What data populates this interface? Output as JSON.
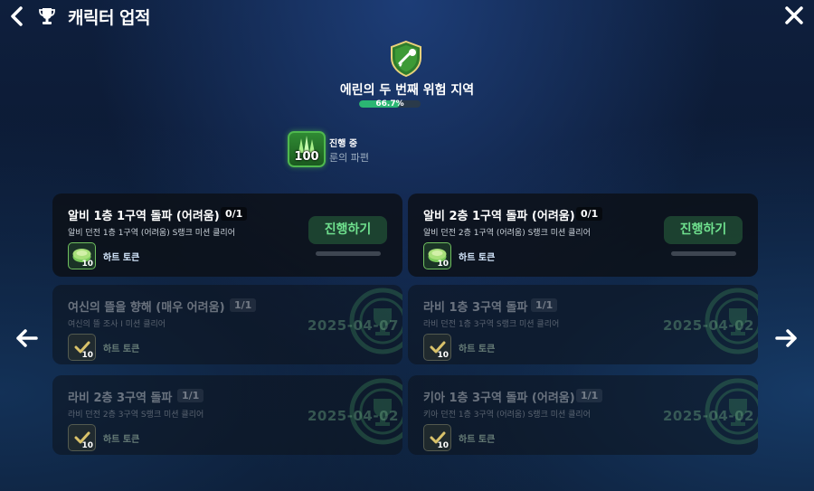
{
  "header": {
    "title": "캐릭터 업적"
  },
  "zone": {
    "title": "에린의 두 번째 위험 지역",
    "progress_text": "66.7%",
    "progress_fraction": 0.667
  },
  "in_progress": {
    "status": "진행 중",
    "name": "룬의 파편",
    "count": "100"
  },
  "cards": [
    {
      "title": "알비 1층 1구역 돌파 (어려움)",
      "count": "0/1",
      "desc": "알비 던전 1층 1구역 (어려움) S랭크 미션 클리어",
      "reward_label": "하트 토큰",
      "reward_qty": "10",
      "button": "진행하기"
    },
    {
      "title": "알비 2층 1구역 돌파 (어려움)",
      "count": "0/1",
      "desc": "알비 던전 2층 1구역 (어려움) S랭크 미션 클리어",
      "reward_label": "하트 토큰",
      "reward_qty": "10",
      "button": "진행하기"
    },
    {
      "title": "여신의 뜰을 향해 (매우 어려움)",
      "count": "1/1",
      "desc": "여신의 뜰 조사 I 미션 클리어",
      "reward_label": "하트 토큰",
      "reward_qty": "10",
      "date": "2025-04-07"
    },
    {
      "title": "라비 1층 3구역 돌파",
      "count": "1/1",
      "desc": "라비 던전 1층 3구역 S랭크 미션 클리어",
      "reward_label": "하트 토큰",
      "reward_qty": "10",
      "date": "2025-04-02"
    },
    {
      "title": "라비 2층 3구역 돌파",
      "count": "1/1",
      "desc": "라비 던전 2층 3구역 S랭크 미션 클리어",
      "reward_label": "하트 토큰",
      "reward_qty": "10",
      "date": "2025-04-02"
    },
    {
      "title": "키아 1층 3구역 돌파 (어려움)",
      "count": "1/1",
      "desc": "키아 던전 1층 3구역 (어려움) S랭크 미션 클리어",
      "reward_label": "하트 토큰",
      "reward_qty": "10",
      "date": "2025-04-02"
    }
  ],
  "colors": {
    "accent_green": "#2bb673",
    "button_text": "#6fe08e"
  }
}
